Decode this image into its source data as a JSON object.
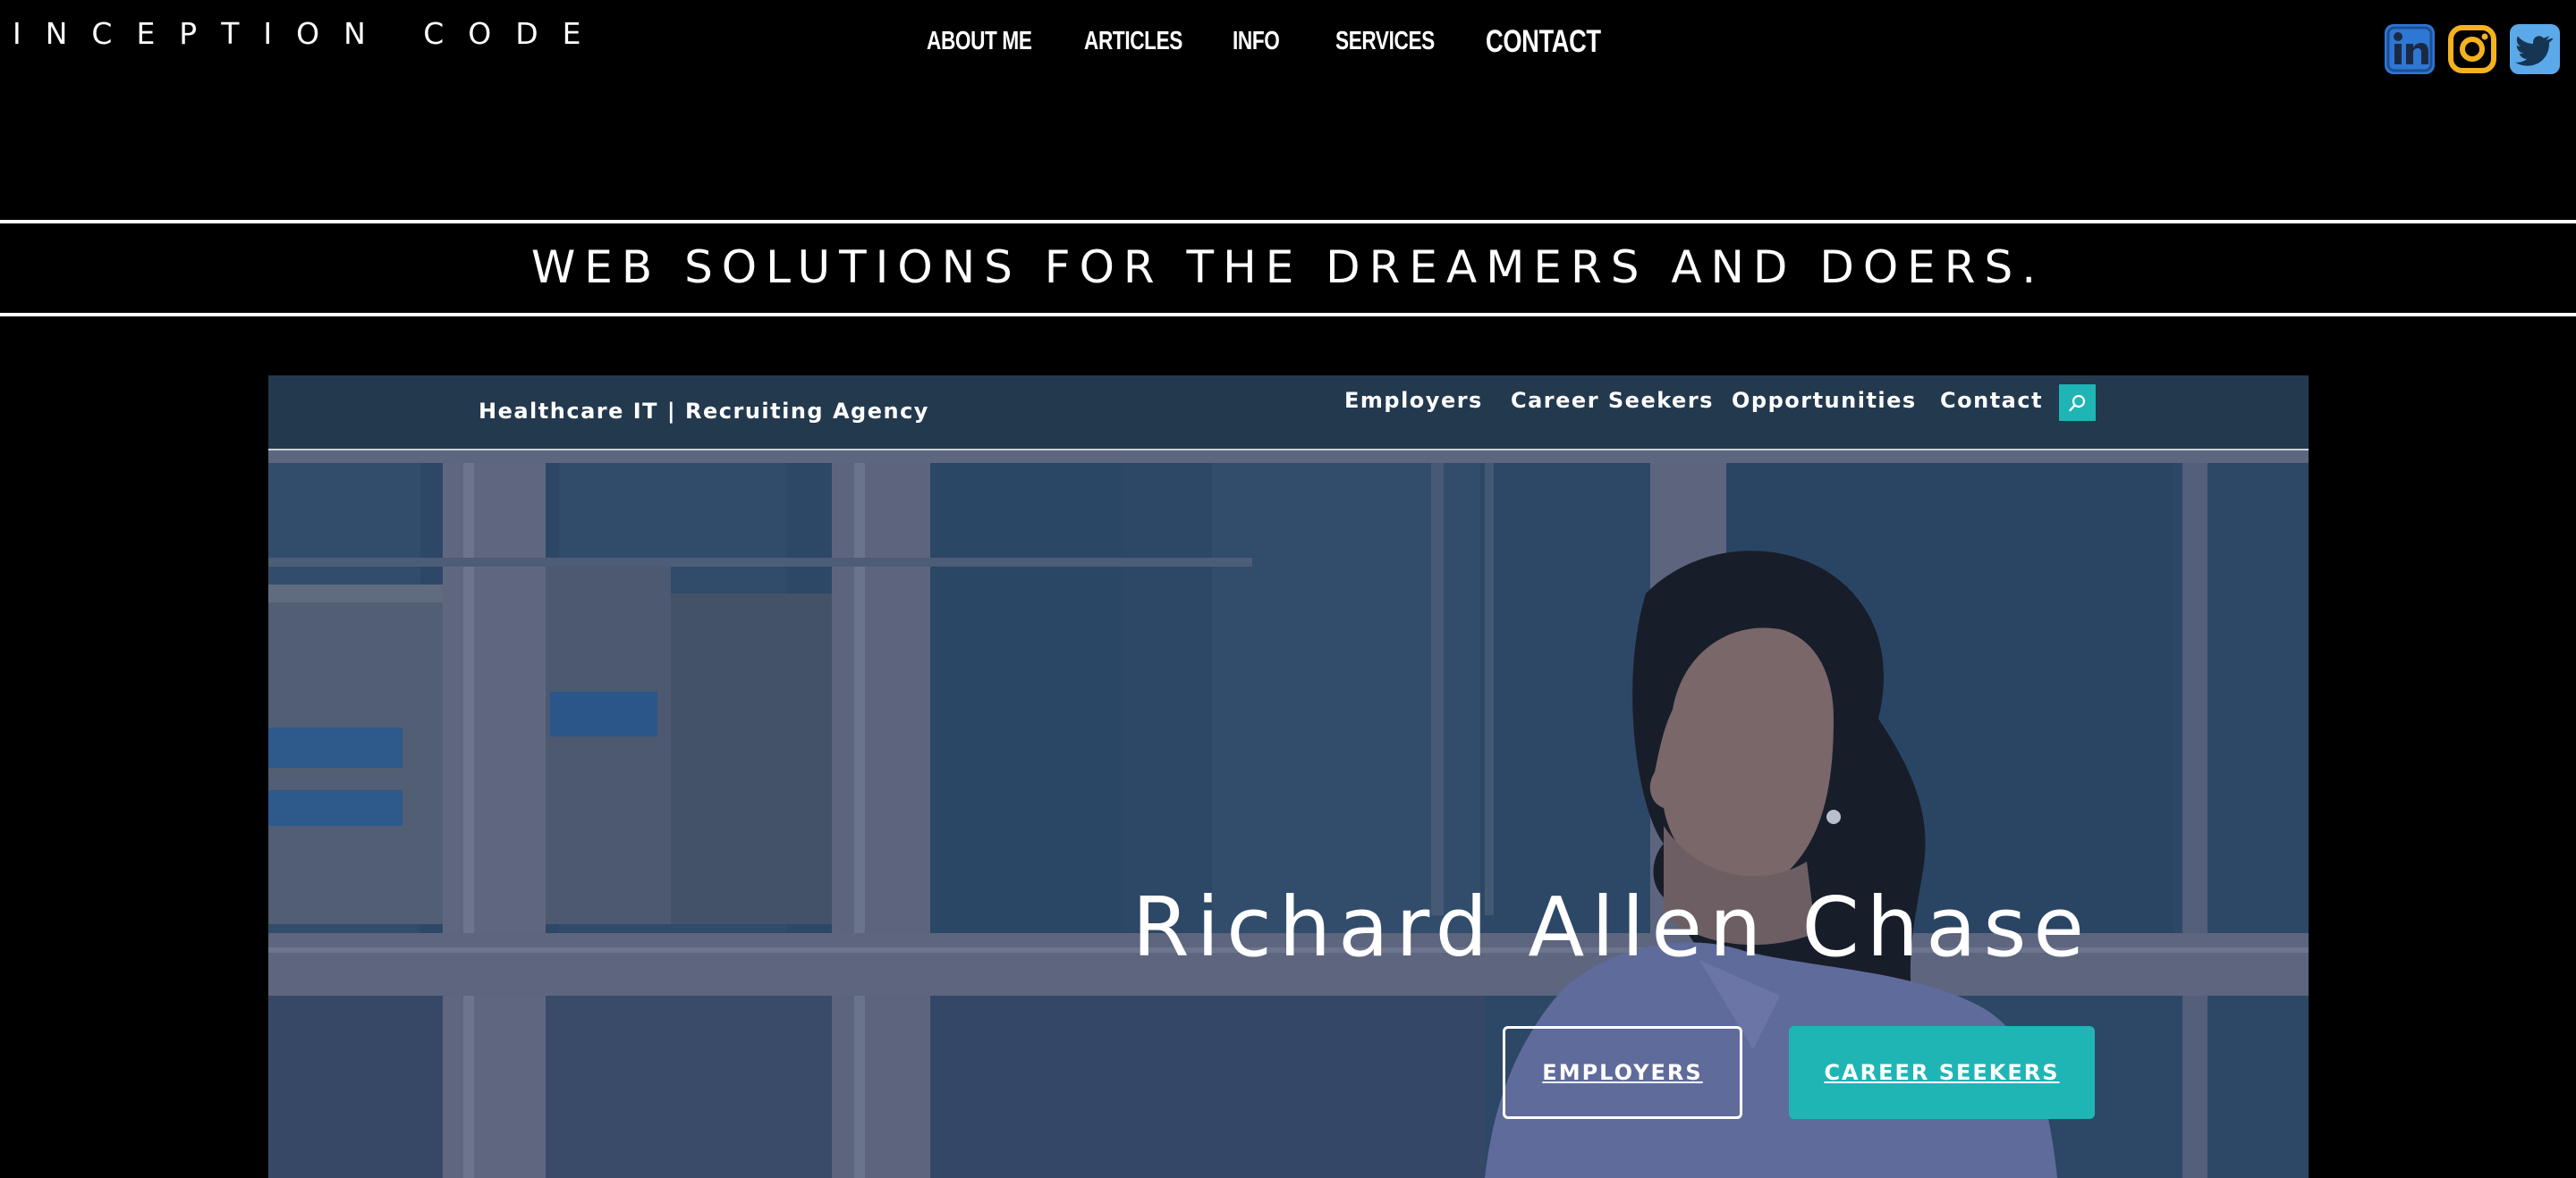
{
  "site": {
    "brand": "INCEPTION CODE",
    "nav": [
      "ABOUT ME",
      "ARTICLES",
      "INFO",
      "SERVICES",
      "CONTACT"
    ],
    "active_nav": "CONTACT",
    "social": [
      {
        "icon": "linkedin-icon",
        "color": "#2f77d4"
      },
      {
        "icon": "instagram-icon",
        "color": "#f4b21f"
      },
      {
        "icon": "twitter-icon",
        "color": "#5ba9e9"
      }
    ],
    "tagline": "WEB SOLUTIONS FOR THE DREAMERS AND DOERS."
  },
  "preview": {
    "header_tagline": "Healthcare IT | Recruiting Agency",
    "nav": [
      "Employers",
      "Career Seekers",
      "Opportunities",
      "Contact"
    ],
    "search_icon": "search-icon",
    "accent_color": "#1fb5b5",
    "hero_title": "Richard Allen Chase",
    "buttons": {
      "employers": "EMPLOYERS",
      "career_seekers": "CAREER SEEKERS"
    }
  }
}
